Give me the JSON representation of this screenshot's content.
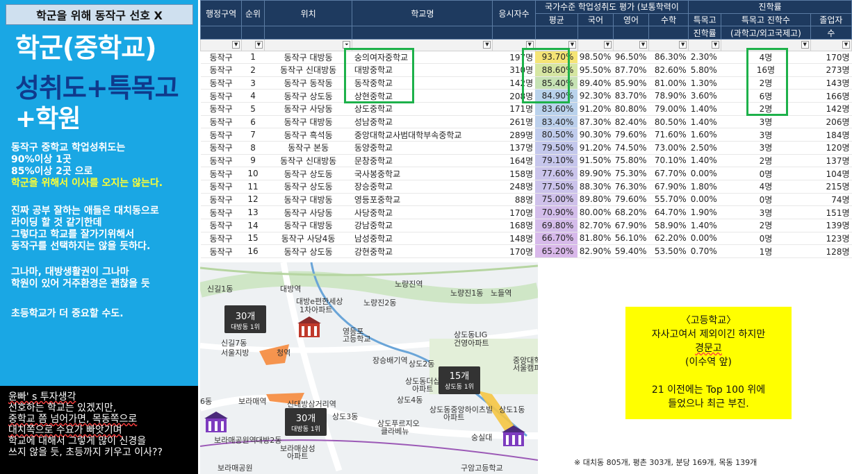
{
  "left": {
    "title": "학군을 위해 동작구 선호 X",
    "big1": "학군(중학교)",
    "big2": "성취도+특목고",
    "big3": "+학원",
    "note1": [
      "동작구 중학교 학업성취도는",
      "90%이상 1곳",
      "85%이상 2곳 으로"
    ],
    "note1_hl": "학군을 위해서 이사를 오지는 않는다.",
    "note2": [
      "진짜 공부 잘하는 애들은 대치동으로",
      "라이딩 할 것 같기한데",
      "그렇다고 학교를 잘가기위해서",
      "동작구를 선택하지는 않을 듯하다."
    ],
    "note3": [
      "그나마, 대방생활권이 그나마",
      "학원이 있어 거주환경은 괜찮을 듯"
    ],
    "note4": "초등학교가 더 중요할 수도.",
    "opinion": [
      "윤빠' s 투자생각",
      "선호하는 학교는 있겠지만,",
      "중학교 쯤 넘어가면, 목동쪽으로",
      "대치쪽으로 수요가 빠앗기며",
      "학교에 대해서 그렇게 많이 신경을",
      "쓰지 않을 듯, 초등까지 키우고 이사??"
    ]
  },
  "table": {
    "headers": {
      "region": "행정구역",
      "rank": "순위",
      "location": "위치",
      "school": "학교명",
      "takers": "응시자수",
      "national_group": "국가수준 학업성취도 평가 (보통학력이",
      "avg": "평균",
      "korean": "국어",
      "english": "영어",
      "math": "수학",
      "advance_group": "진학률",
      "special_rate_1": "특목고",
      "special_rate_2": "진학률",
      "special_count_1": "특목고 진학수",
      "special_count_2": "(과학고/외고국제고)",
      "grads_1": "졸업자",
      "grads_2": "수"
    },
    "rows": [
      {
        "region": "동작구",
        "rank": "1",
        "location": "동작구 대방동",
        "school": "숭의여자중학교",
        "takers": "197명",
        "avg": "93.70%",
        "korean": "98.50%",
        "english": "96.50%",
        "math": "86.30%",
        "rate": "2.30%",
        "count": "4명",
        "grads": "170명"
      },
      {
        "region": "동작구",
        "rank": "2",
        "location": "동작구 신대방동",
        "school": "대방중학교",
        "takers": "310명",
        "avg": "88.60%",
        "korean": "95.50%",
        "english": "87.70%",
        "math": "82.60%",
        "rate": "5.80%",
        "count": "16명",
        "grads": "273명"
      },
      {
        "region": "동작구",
        "rank": "3",
        "location": "동작구 동작동",
        "school": "동작중학교",
        "takers": "142명",
        "avg": "85.40%",
        "korean": "89.40%",
        "english": "85.90%",
        "math": "81.00%",
        "rate": "1.30%",
        "count": "2명",
        "grads": "143명"
      },
      {
        "region": "동작구",
        "rank": "4",
        "location": "동작구 상도동",
        "school": "상현중학교",
        "takers": "208명",
        "avg": "84.90%",
        "korean": "92.30%",
        "english": "83.70%",
        "math": "78.90%",
        "rate": "3.60%",
        "count": "6명",
        "grads": "166명"
      },
      {
        "region": "동작구",
        "rank": "5",
        "location": "동작구 사당동",
        "school": "상도중학교",
        "takers": "171명",
        "avg": "83.60%",
        "korean": "91.20%",
        "english": "80.80%",
        "math": "79.00%",
        "rate": "1.40%",
        "count": "2명",
        "grads": "142명"
      },
      {
        "region": "동작구",
        "rank": "6",
        "location": "동작구 대방동",
        "school": "성남중학교",
        "takers": "261명",
        "avg": "83.40%",
        "korean": "87.30%",
        "english": "82.40%",
        "math": "80.50%",
        "rate": "1.40%",
        "count": "3명",
        "grads": "206명"
      },
      {
        "region": "동작구",
        "rank": "7",
        "location": "동작구 흑석동",
        "school": "중앙대학교사범대학부속중학교",
        "takers": "289명",
        "avg": "80.50%",
        "korean": "90.30%",
        "english": "79.60%",
        "math": "71.60%",
        "rate": "1.60%",
        "count": "3명",
        "grads": "184명"
      },
      {
        "region": "동작구",
        "rank": "8",
        "location": "동작구 본동",
        "school": "동양중학교",
        "takers": "137명",
        "avg": "79.50%",
        "korean": "91.20%",
        "english": "74.50%",
        "math": "73.00%",
        "rate": "2.50%",
        "count": "3명",
        "grads": "120명"
      },
      {
        "region": "동작구",
        "rank": "9",
        "location": "동작구 신대방동",
        "school": "문창중학교",
        "takers": "164명",
        "avg": "79.10%",
        "korean": "91.50%",
        "english": "75.80%",
        "math": "70.10%",
        "rate": "1.40%",
        "count": "2명",
        "grads": "137명"
      },
      {
        "region": "동작구",
        "rank": "10",
        "location": "동작구 상도동",
        "school": "국사봉중학교",
        "takers": "158명",
        "avg": "77.60%",
        "korean": "89.90%",
        "english": "75.30%",
        "math": "67.70%",
        "rate": "0.00%",
        "count": "0명",
        "grads": "104명"
      },
      {
        "region": "동작구",
        "rank": "11",
        "location": "동작구 상도동",
        "school": "장승중학교",
        "takers": "248명",
        "avg": "77.50%",
        "korean": "88.30%",
        "english": "76.30%",
        "math": "67.90%",
        "rate": "1.80%",
        "count": "4명",
        "grads": "215명"
      },
      {
        "region": "동작구",
        "rank": "12",
        "location": "동작구 대방동",
        "school": "영등포중학교",
        "takers": "88명",
        "avg": "75.00%",
        "korean": "89.80%",
        "english": "79.60%",
        "math": "55.70%",
        "rate": "0.00%",
        "count": "0명",
        "grads": "74명"
      },
      {
        "region": "동작구",
        "rank": "13",
        "location": "동작구 사당동",
        "school": "사당중학교",
        "takers": "170명",
        "avg": "70.90%",
        "korean": "80.00%",
        "english": "68.20%",
        "math": "64.70%",
        "rate": "1.90%",
        "count": "3명",
        "grads": "151명"
      },
      {
        "region": "동작구",
        "rank": "14",
        "location": "동작구 대방동",
        "school": "강남중학교",
        "takers": "168명",
        "avg": "69.80%",
        "korean": "82.70%",
        "english": "67.90%",
        "math": "58.90%",
        "rate": "1.40%",
        "count": "2명",
        "grads": "139명"
      },
      {
        "region": "동작구",
        "rank": "15",
        "location": "동작구 사당4동",
        "school": "남성중학교",
        "takers": "148명",
        "avg": "66.70%",
        "korean": "81.80%",
        "english": "56.10%",
        "math": "62.20%",
        "rate": "0.00%",
        "count": "0명",
        "grads": "123명"
      },
      {
        "region": "동작구",
        "rank": "16",
        "location": "동작구 상도동",
        "school": "강현중학교",
        "takers": "170명",
        "avg": "65.20%",
        "korean": "82.90%",
        "english": "59.40%",
        "math": "53.50%",
        "rate": "0.70%",
        "count": "1명",
        "grads": "128명"
      }
    ],
    "avg_colors": [
      "#f5e476",
      "#d6e6a2",
      "#c6e2b4",
      "#b9d3ec",
      "#bad2ec",
      "#bcd0ec",
      "#c0cced",
      "#c4c8ec",
      "#c6c6ec",
      "#cac4eb",
      "#cbc3eb",
      "#cfc1ea",
      "#d3bdea",
      "#d4bcea",
      "#d7baea",
      "#d9b8ea"
    ],
    "highlight_color": "#1db14a"
  },
  "map": {
    "labels": [
      "신길1동",
      "대방역",
      "노량진역",
      "노량진1동",
      "노들역",
      "노량진2동",
      "대방e편한세상",
      "1차아파트",
      "영등포",
      "고등학교",
      "상도동LIG",
      "건영아파트",
      "신길7동",
      "서울지방",
      "청역",
      "장승배기역",
      "상도2동",
      "중앙대학",
      "서울캠퍼",
      "상도동더샵",
      "아파트",
      "상도4동",
      "보라매역",
      "신대방삼거리역",
      "상도3동",
      "상도동중앙하이츠빌",
      "아파트",
      "상도1동",
      "상도푸르지오",
      "클라베뉴",
      "숭실대",
      "6동",
      "보라매공원역",
      "대방2동",
      "보라매삼성",
      "아파트",
      "구암고등학교",
      "보라매공원"
    ],
    "badges": [
      {
        "count": "30개",
        "sub": "대방동 1위"
      },
      {
        "count": "15개",
        "sub": "상도동 1위"
      },
      {
        "count": "30개",
        "sub": "대방동 1위"
      }
    ]
  },
  "highschool": {
    "lines": [
      "〈고등학교〉",
      "자사고여서 제외이긴 하지만",
      "경문고",
      "(이수역 앞)",
      "",
      "21 이전에는 Top 100 위에",
      "들었으나 최근 부진."
    ]
  },
  "footnote": "※ 대치동 805개, 평촌 303개, 분당 169개, 목동 139개"
}
